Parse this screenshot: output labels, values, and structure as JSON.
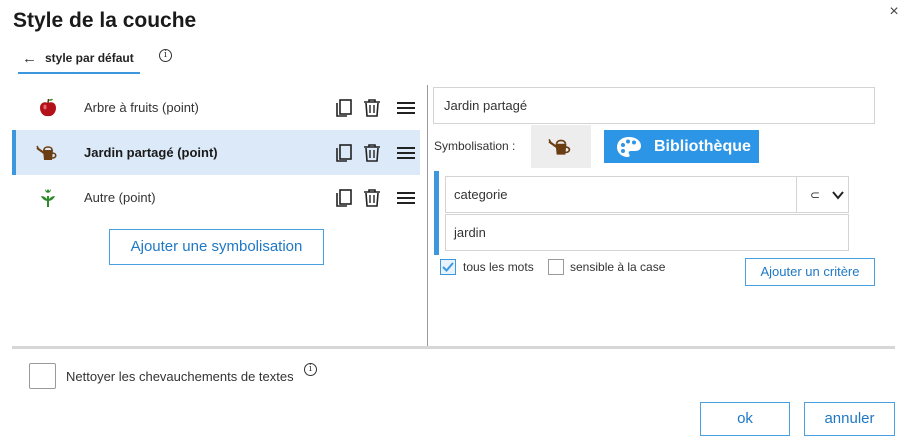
{
  "dialog": {
    "title": "Style de la couche",
    "close_glyph": "×"
  },
  "tab": {
    "arrow": "←",
    "label": "style par défaut",
    "info_glyph": "i"
  },
  "symbolizations": [
    {
      "label": "Arbre à fruits (point)",
      "icon": "apple-icon",
      "selected": false
    },
    {
      "label": "Jardin partagé (point)",
      "icon": "watering-can-icon",
      "selected": true
    },
    {
      "label": "Autre (point)",
      "icon": "flower-icon",
      "selected": false
    }
  ],
  "add_symbolization_label": "Ajouter une symbolisation",
  "editor": {
    "name_value": "Jardin partagé",
    "symbolisation_label": "Symbolisation :",
    "library_label": "Bibliothèque",
    "criterion": {
      "field_value": "categorie",
      "operator": "⊂",
      "value": "jardin"
    },
    "whole_words_label": "tous les mots",
    "whole_words_checked": true,
    "case_sensitive_label": "sensible à la case",
    "case_sensitive_checked": false,
    "add_criterion_label": "Ajouter un critère"
  },
  "footer": {
    "clean_overlap_label": "Nettoyer les chevauchements de textes",
    "clean_overlap_checked": false,
    "info_glyph": "i",
    "ok_label": "ok",
    "cancel_label": "annuler"
  },
  "colors": {
    "accent": "#3d97dd",
    "library_button": "#2d95e6",
    "selected_row": "#dce9f8"
  }
}
